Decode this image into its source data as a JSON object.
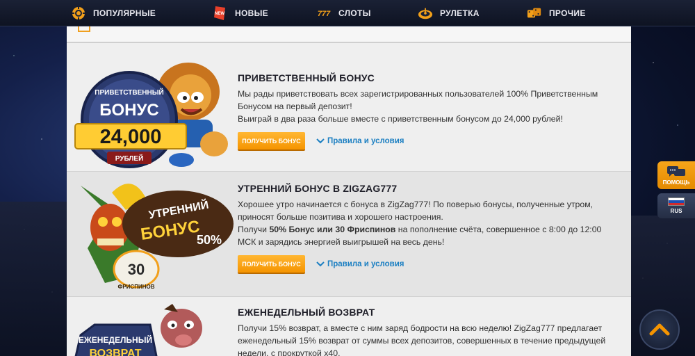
{
  "nav": {
    "items": [
      {
        "label": "ПОПУЛЯРНЫЕ",
        "icon": "chip-icon"
      },
      {
        "label": "НОВЫЕ",
        "icon": "new-badge-icon",
        "badge": "NEW"
      },
      {
        "label": "СЛОТЫ",
        "icon": "slots-777-icon",
        "icon_text": "777"
      },
      {
        "label": "РУЛЕТКА",
        "icon": "roulette-icon"
      },
      {
        "label": "ПРОЧИЕ",
        "icon": "dice-icon"
      }
    ]
  },
  "promos": [
    {
      "title": "ПРИВЕТСТВЕННЫЙ БОНУС",
      "lines": [
        "Мы рады приветствовать всех зарегистрированных пользователей 100% Приветственным Бонусом на первый депозит!",
        "Выиграй в два раза больше вместе с приветственным бонусом до 24,000 рублей!"
      ],
      "image": {
        "top": "ПРИВЕТСТВЕННЫЙ",
        "word": "БОНУС",
        "amount": "24,000",
        "bottom": "РУБЛЕЙ"
      },
      "button": "ПОЛУЧИТЬ БОНУС",
      "rules": "Правила и условия"
    },
    {
      "title": "УТРЕННИЙ БОНУС В ZIGZAG777",
      "line1": "Хорошее утро начинается с бонуса в ZigZag777! По поверью бонусы, полученные утром, приносят больше позитива и хорошего настроения.",
      "line2_pre": "Получи ",
      "line2_bold": "50% Бонус или 30 Фриспинов",
      "line2_post": " на пополнение счёта, совершенное с 8:00 до 12:00 МСК и зарядись энергией выигрышей на весь день!",
      "image": {
        "w1": "УТРЕННИЙ",
        "w2": "БОНУС",
        "pct": "50%",
        "spins": "30",
        "spins_word": "ФРИСПИНОВ"
      },
      "button": "ПОЛУЧИТЬ БОНУС",
      "rules": "Правила и условия"
    },
    {
      "title": "ЕЖЕНЕДЕЛЬНЫЙ ВОЗВРАТ",
      "line1": "Получи 15% возврат, а вместе с ним заряд бодрости на всю неделю! ZigZag777 предлагает еженедельный 15% возврат от суммы всех депозитов, совершенных в течение предыдущей недели, с прокруткой х40.",
      "image": {
        "w1": "ЕЖЕНЕДЕЛЬНЫЙ",
        "w2": "ВОЗВРАТ"
      }
    }
  ],
  "widgets": {
    "help": "ПОМОЩЬ",
    "lang": "RUS"
  },
  "colors": {
    "accent": "#f59400",
    "link": "#1b7fc2",
    "nav_bg": "#131a2c"
  }
}
